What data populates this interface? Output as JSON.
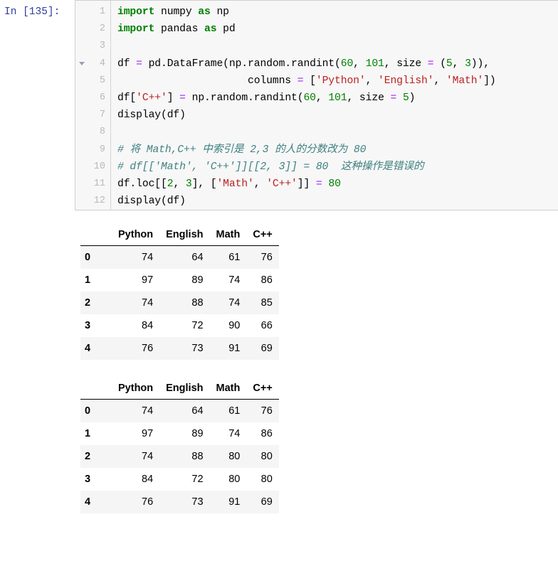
{
  "cell": {
    "prompt": "In [135]:",
    "execution_count": "135",
    "fold_marker_line": 4,
    "line_numbers": [
      "1",
      "2",
      "3",
      "4",
      "5",
      "6",
      "7",
      "8",
      "9",
      "10",
      "11",
      "12"
    ],
    "code_lines": [
      {
        "n": 1,
        "tokens": [
          {
            "t": "import",
            "c": "kw"
          },
          {
            "t": " numpy ",
            "c": "bi"
          },
          {
            "t": "as",
            "c": "kw"
          },
          {
            "t": " np",
            "c": "bi"
          }
        ]
      },
      {
        "n": 2,
        "tokens": [
          {
            "t": "import",
            "c": "kw"
          },
          {
            "t": " pandas ",
            "c": "bi"
          },
          {
            "t": "as",
            "c": "kw"
          },
          {
            "t": " pd",
            "c": "bi"
          }
        ]
      },
      {
        "n": 3,
        "tokens": []
      },
      {
        "n": 4,
        "tokens": [
          {
            "t": "df ",
            "c": "bi"
          },
          {
            "t": "=",
            "c": "op"
          },
          {
            "t": " pd.DataFrame(np.random.randint(",
            "c": "bi"
          },
          {
            "t": "60",
            "c": "num"
          },
          {
            "t": ", ",
            "c": "bi"
          },
          {
            "t": "101",
            "c": "num"
          },
          {
            "t": ", size ",
            "c": "bi"
          },
          {
            "t": "=",
            "c": "op"
          },
          {
            "t": " (",
            "c": "bi"
          },
          {
            "t": "5",
            "c": "num"
          },
          {
            "t": ", ",
            "c": "bi"
          },
          {
            "t": "3",
            "c": "num"
          },
          {
            "t": ")),",
            "c": "bi"
          }
        ]
      },
      {
        "n": 5,
        "tokens": [
          {
            "t": "                     columns ",
            "c": "bi"
          },
          {
            "t": "=",
            "c": "op"
          },
          {
            "t": " [",
            "c": "bi"
          },
          {
            "t": "'Python'",
            "c": "str"
          },
          {
            "t": ", ",
            "c": "bi"
          },
          {
            "t": "'English'",
            "c": "str"
          },
          {
            "t": ", ",
            "c": "bi"
          },
          {
            "t": "'Math'",
            "c": "str"
          },
          {
            "t": "])",
            "c": "bi"
          }
        ]
      },
      {
        "n": 6,
        "tokens": [
          {
            "t": "df[",
            "c": "bi"
          },
          {
            "t": "'C++'",
            "c": "str"
          },
          {
            "t": "] ",
            "c": "bi"
          },
          {
            "t": "=",
            "c": "op"
          },
          {
            "t": " np.random.randint(",
            "c": "bi"
          },
          {
            "t": "60",
            "c": "num"
          },
          {
            "t": ", ",
            "c": "bi"
          },
          {
            "t": "101",
            "c": "num"
          },
          {
            "t": ", size ",
            "c": "bi"
          },
          {
            "t": "=",
            "c": "op"
          },
          {
            "t": " ",
            "c": "bi"
          },
          {
            "t": "5",
            "c": "num"
          },
          {
            "t": ")",
            "c": "bi"
          }
        ]
      },
      {
        "n": 7,
        "tokens": [
          {
            "t": "display(df)",
            "c": "bi"
          }
        ]
      },
      {
        "n": 8,
        "tokens": []
      },
      {
        "n": 9,
        "tokens": [
          {
            "t": "# 将 Math,C++ 中索引是 2,3 的人的分数改为 80",
            "c": "cmt"
          }
        ]
      },
      {
        "n": 10,
        "tokens": [
          {
            "t": "# df[['Math', 'C++']][[2, 3]] = 80  这种操作是错误的",
            "c": "cmt"
          }
        ]
      },
      {
        "n": 11,
        "tokens": [
          {
            "t": "df.loc[[",
            "c": "bi"
          },
          {
            "t": "2",
            "c": "num"
          },
          {
            "t": ", ",
            "c": "bi"
          },
          {
            "t": "3",
            "c": "num"
          },
          {
            "t": "], [",
            "c": "bi"
          },
          {
            "t": "'Math'",
            "c": "str"
          },
          {
            "t": ", ",
            "c": "bi"
          },
          {
            "t": "'C++'",
            "c": "str"
          },
          {
            "t": "]] ",
            "c": "bi"
          },
          {
            "t": "=",
            "c": "op"
          },
          {
            "t": " ",
            "c": "bi"
          },
          {
            "t": "80",
            "c": "num"
          }
        ]
      },
      {
        "n": 12,
        "tokens": [
          {
            "t": "display(df)",
            "c": "bi"
          }
        ]
      }
    ],
    "code_plain": [
      "import numpy as np",
      "import pandas as pd",
      "",
      "df = pd.DataFrame(np.random.randint(60, 101, size = (5, 3)),",
      "                     columns = ['Python', 'English', 'Math'])",
      "df['C++'] = np.random.randint(60, 101, size = 5)",
      "display(df)",
      "",
      "# 将 Math,C++ 中索引是 2,3 的人的分数改为 80",
      "# df[['Math', 'C++']][[2, 3]] = 80  这种操作是错误的",
      "df.loc[[2, 3], ['Math', 'C++']] = 80",
      "display(df)"
    ]
  },
  "outputs": [
    {
      "name": "dataframe-before",
      "index_header": "",
      "columns": [
        "Python",
        "English",
        "Math",
        "C++"
      ],
      "index": [
        "0",
        "1",
        "2",
        "3",
        "4"
      ],
      "rows": [
        [
          "74",
          "64",
          "61",
          "76"
        ],
        [
          "97",
          "89",
          "74",
          "86"
        ],
        [
          "74",
          "88",
          "74",
          "85"
        ],
        [
          "84",
          "72",
          "90",
          "66"
        ],
        [
          "76",
          "73",
          "91",
          "69"
        ]
      ]
    },
    {
      "name": "dataframe-after",
      "index_header": "",
      "columns": [
        "Python",
        "English",
        "Math",
        "C++"
      ],
      "index": [
        "0",
        "1",
        "2",
        "3",
        "4"
      ],
      "rows": [
        [
          "74",
          "64",
          "61",
          "76"
        ],
        [
          "97",
          "89",
          "74",
          "86"
        ],
        [
          "74",
          "88",
          "80",
          "80"
        ],
        [
          "84",
          "72",
          "80",
          "80"
        ],
        [
          "76",
          "73",
          "91",
          "69"
        ]
      ]
    }
  ],
  "colors": {
    "keyword": "#008000",
    "number": "#008000",
    "string": "#BA2121",
    "operator": "#AA22FF",
    "comment": "#408080",
    "prompt": "#303F9F",
    "cell_background": "#f7f7f7",
    "cell_border": "#cfcfcf",
    "linenumber": "#b8b8b8",
    "table_stripe": "#f5f5f5"
  }
}
